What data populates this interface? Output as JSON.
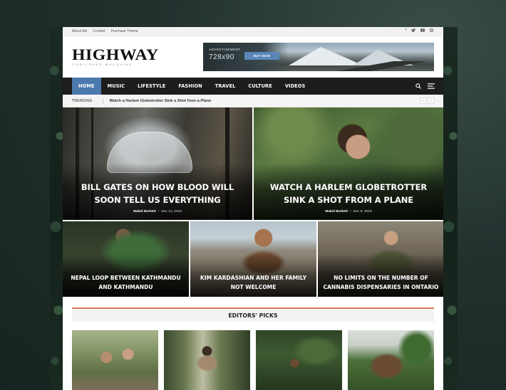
{
  "topbar": {
    "links": [
      "About Me",
      "Contact",
      "Purchase Theme"
    ],
    "social_icons": [
      "facebook-icon",
      "twitter-icon",
      "youtube-icon",
      "instagram-icon"
    ]
  },
  "header": {
    "logo": "HIGHWAY",
    "tagline": "PUBLISHER MAGAZINE"
  },
  "ad": {
    "label": "ADVERTISEMENT",
    "size": "728x90",
    "button": "BUY NOW"
  },
  "nav": {
    "items": [
      "HOME",
      "MUSIC",
      "LIFESTYLE",
      "FASHION",
      "TRAVEL",
      "CULTURE",
      "VIDEOS"
    ],
    "active": "HOME",
    "accent": "#4c79ad"
  },
  "trending": {
    "label": "TRENDING",
    "headline": "Watch a Harlem Globetrotter Sink a Shot from a Plane"
  },
  "featured_big": [
    {
      "title": "Bill Gates on How Blood Will Soon Tell Us Everything",
      "author": "Mabel Burkett",
      "date": "Dec 12, 2018"
    },
    {
      "title": "Watch a Harlem Globetrotter Sink a Shot from a Plane",
      "author": "Mabel Burkett",
      "date": "Dec 9, 2018"
    }
  ],
  "featured_small": [
    {
      "title": "Nepal Loop Between Kathmandu and Kathmandu"
    },
    {
      "title": "Kim Kardashian and Her Family Not Welcome"
    },
    {
      "title": "No Limits on the Number of Cannabis Dispensaries in Ontario"
    }
  ],
  "editors_picks": {
    "heading": "EDITORS' PICKS",
    "accent": "#d9765a"
  }
}
